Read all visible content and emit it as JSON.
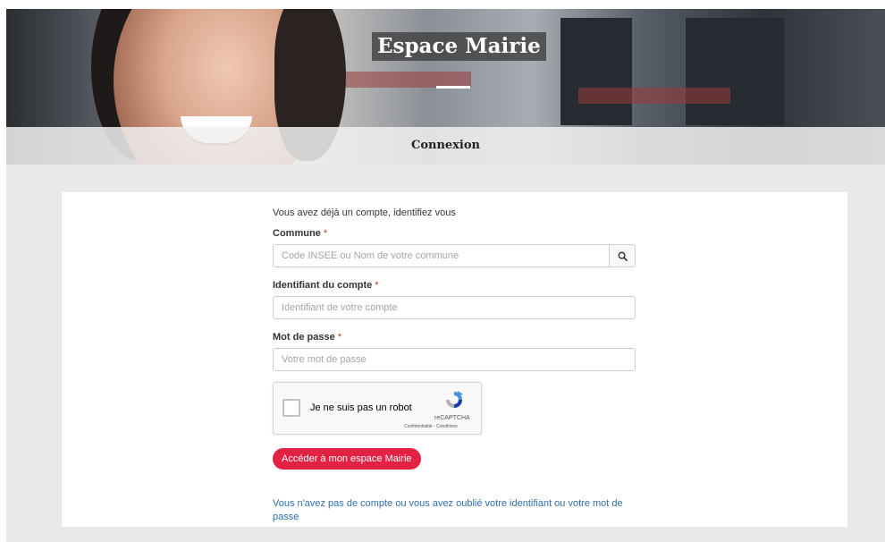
{
  "hero": {
    "title": "Espace Mairie",
    "subtitle": "Connexion"
  },
  "form": {
    "intro": "Vous avez déjà un compte, identifiez vous",
    "required_marker": "*",
    "commune": {
      "label": "Commune",
      "placeholder": "Code INSEE ou Nom de votre commune"
    },
    "identifiant": {
      "label": "Identifiant du compte",
      "placeholder": "Identifiant de votre compte"
    },
    "password": {
      "label": "Mot de passe",
      "placeholder": "Votre mot de passe"
    },
    "captcha": {
      "text": "Je ne suis pas un robot",
      "brand": "reCAPTCHA",
      "terms": "Confidentialité - Conditions"
    },
    "submit_label": "Accéder à mon espace Mairie",
    "help_link": "Vous n'avez pas de compte ou vous avez oublié votre identifiant ou votre mot de passe"
  },
  "icons": {
    "search": "search-icon",
    "recaptcha": "recaptcha-logo-icon"
  },
  "colors": {
    "accent": "#e32142",
    "link": "#2f6eaa",
    "background": "#e9e9e9"
  }
}
